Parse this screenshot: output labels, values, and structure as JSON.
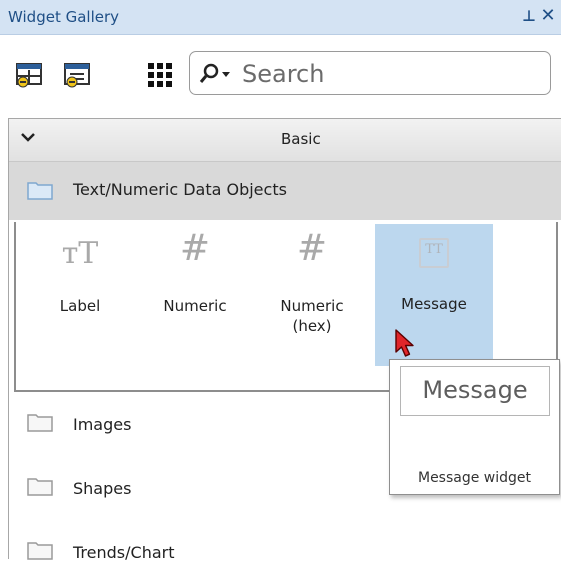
{
  "window": {
    "title": "Widget Gallery",
    "pin_icon": "pin-icon",
    "close_icon": "close-icon"
  },
  "toolbar": {
    "buttons": [
      "add-widget-icon",
      "edit-widget-icon",
      "grid-view-icon"
    ],
    "search_placeholder": "Search"
  },
  "category": {
    "label": "Basic",
    "expanded": true
  },
  "group": {
    "label": "Text/Numeric Data Objects",
    "widgets": [
      {
        "glyph": "TT",
        "label": "Label"
      },
      {
        "glyph": "#",
        "label": "Numeric"
      },
      {
        "glyph": "#",
        "label": "Numeric\n(hex)"
      },
      {
        "glyph": "TT",
        "label": "Message",
        "selected": true
      }
    ]
  },
  "folders": [
    {
      "label": "Images"
    },
    {
      "label": "Shapes"
    },
    {
      "label": "Trends/Chart"
    }
  ],
  "tooltip": {
    "preview_text": "Message",
    "caption": "Message widget"
  },
  "colors": {
    "title_bg": "#d4e3f3",
    "selected_bg": "#bcd7ee",
    "group_bg": "#d9d9d9"
  }
}
